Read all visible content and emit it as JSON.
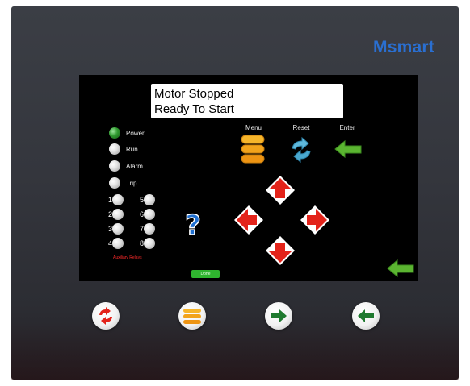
{
  "brand": "Msmart",
  "display": {
    "line1": "Motor Stopped",
    "line2": "Ready To Start"
  },
  "indicators": [
    {
      "label": "Power",
      "state": "on",
      "color": "#2f9a2f"
    },
    {
      "label": "Run",
      "state": "off"
    },
    {
      "label": "Alarm",
      "state": "off"
    },
    {
      "label": "Trip",
      "state": "off"
    }
  ],
  "aux_relays": {
    "left": [
      "1",
      "2",
      "3",
      "4"
    ],
    "right": [
      "5",
      "6",
      "7",
      "8"
    ],
    "caption": "Auxiliary Relays"
  },
  "keys": {
    "menu": "Menu",
    "reset": "Reset",
    "enter": "Enter"
  },
  "done_label": "Done",
  "icons": {
    "menu": "stacked-bars-icon",
    "reset": "refresh-arrows-icon",
    "enter": "green-arrow-left-icon",
    "help": "question-mark-icon",
    "up": "red-arrow-up-icon",
    "down": "red-arrow-down-icon",
    "left": "red-arrow-left-icon",
    "right": "red-arrow-right-icon"
  },
  "colors": {
    "brand": "#2a6fd1",
    "arrow_red": "#e3231a",
    "enter_green": "#5bb531",
    "menu_orange": "#f2a31b",
    "reset_blue": "#4aa8cf",
    "help_blue": "#1f6fd0"
  }
}
